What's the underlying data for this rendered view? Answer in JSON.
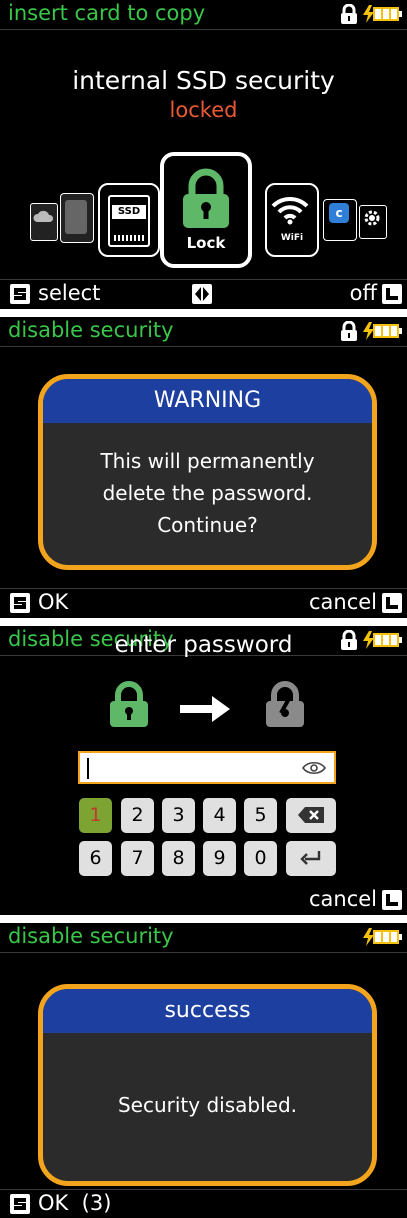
{
  "screens": [
    {
      "title": "insert card to copy",
      "line1": "internal SSD security",
      "line2": "locked",
      "carousel": {
        "selected_label": "Lock",
        "ssd_label": "SSD",
        "wifi_label": "WiFi",
        "app_label": "APP",
        "setting_label": "Setting",
        "ext_label": "Ext SSD",
        "cloud_label": "Cloud Service"
      },
      "footer": {
        "left_key": "S",
        "left": "select",
        "right": "off",
        "right_key": "L"
      }
    },
    {
      "title": "disable security",
      "dialog": {
        "header": "WARNING",
        "lines": [
          "This will permanently",
          "delete the password.",
          "Continue?"
        ]
      },
      "footer": {
        "left_key": "S",
        "left": "OK",
        "right": "cancel",
        "right_key": "L"
      }
    },
    {
      "title": "disable security",
      "prompt": "enter password",
      "keypad": {
        "row1": [
          "1",
          "2",
          "3",
          "4",
          "5"
        ],
        "row2": [
          "6",
          "7",
          "8",
          "9",
          "0"
        ],
        "selected": "1"
      },
      "footer": {
        "right": "cancel",
        "right_key": "L"
      }
    },
    {
      "title": "disable security",
      "dialog": {
        "header": "success",
        "message": "Security disabled."
      },
      "footer": {
        "left_key": "S",
        "left": "OK  (3)"
      }
    }
  ],
  "colors": {
    "title_green": "#39c649",
    "locked_orange": "#e85a34",
    "dialog_border": "#f2a51c",
    "dialog_header": "#1d3fa0",
    "lock_green": "#5fb868",
    "battery_yellow": "#f4c20d"
  }
}
